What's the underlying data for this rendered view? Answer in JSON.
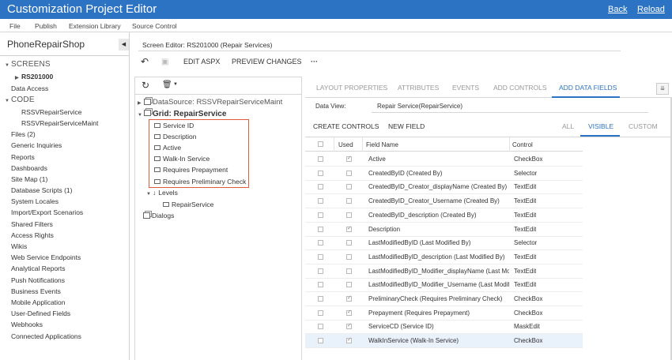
{
  "app": {
    "title": "Customization Project Editor",
    "back": "Back",
    "reload": "Reload"
  },
  "menu": {
    "file": "File",
    "publish": "Publish",
    "extension_library": "Extension Library",
    "source_control": "Source Control"
  },
  "sidebar": {
    "project": "PhoneRepairShop",
    "screens_label": "SCREENS",
    "screen_item": "RS201000",
    "data_access": "Data Access",
    "code_label": "CODE",
    "code_items": [
      "RSSVRepairService",
      "RSSVRepairServiceMaint"
    ],
    "items": [
      "Files (2)",
      "Generic Inquiries",
      "Reports",
      "Dashboards",
      "Site Map (1)",
      "Database Scripts (1)",
      "System Locales",
      "Import/Export Scenarios",
      "Shared Filters",
      "Access Rights",
      "Wikis",
      "Web Service Endpoints",
      "Analytical Reports",
      "Push Notifications",
      "Business Events",
      "Mobile Application",
      "User-Defined Fields",
      "Webhooks",
      "Connected Applications"
    ]
  },
  "editor": {
    "header": "Screen Editor: RS201000 (Repair Services)",
    "edit_aspx": "EDIT ASPX",
    "preview_changes": "PREVIEW CHANGES",
    "more": "···"
  },
  "tree": {
    "datasource": "DataSource: RSSVRepairServiceMaint",
    "grid": "Grid: RepairService",
    "fields": [
      "Service ID",
      "Description",
      "Active",
      "Walk-In Service",
      "Requires Prepayment",
      "Requires Preliminary Check"
    ],
    "levels": "Levels",
    "level_item": "RepairService",
    "dialogs": "Dialogs"
  },
  "tabs": [
    "LAYOUT PROPERTIES",
    "ATTRIBUTES",
    "EVENTS",
    "ADD CONTROLS",
    "ADD DATA FIELDS"
  ],
  "add_fields": {
    "data_view_label": "Data View:",
    "data_view_value": "Repair Service(RepairService)",
    "create_controls": "CREATE CONTROLS",
    "new_field": "NEW FIELD",
    "filters": [
      "ALL",
      "VISIBLE",
      "CUSTOM"
    ],
    "columns": {
      "used": "Used",
      "field_name": "Field Name",
      "control": "Control"
    },
    "rows": [
      {
        "used": true,
        "field": "Active",
        "control": "CheckBox"
      },
      {
        "used": false,
        "field": "CreatedByID (Created By)",
        "control": "Selector"
      },
      {
        "used": false,
        "field": "CreatedByID_Creator_displayName (Created By)",
        "control": "TextEdit"
      },
      {
        "used": false,
        "field": "CreatedByID_Creator_Username (Created By)",
        "control": "TextEdit"
      },
      {
        "used": false,
        "field": "CreatedByID_description (Created By)",
        "control": "TextEdit"
      },
      {
        "used": true,
        "field": "Description",
        "control": "TextEdit"
      },
      {
        "used": false,
        "field": "LastModifiedByID (Last Modified By)",
        "control": "Selector"
      },
      {
        "used": false,
        "field": "LastModifiedByID_description (Last Modified By)",
        "control": "TextEdit"
      },
      {
        "used": false,
        "field": "LastModifiedByID_Modifier_displayName (Last Mo",
        "control": "TextEdit"
      },
      {
        "used": false,
        "field": "LastModifiedByID_Modifier_Username (Last Modifie",
        "control": "TextEdit"
      },
      {
        "used": true,
        "field": "PreliminaryCheck (Requires Preliminary Check)",
        "control": "CheckBox"
      },
      {
        "used": true,
        "field": "Prepayment (Requires Prepayment)",
        "control": "CheckBox"
      },
      {
        "used": true,
        "field": "ServiceCD (Service ID)",
        "control": "MaskEdit"
      },
      {
        "used": true,
        "field": "WalkInService (Walk-In Service)",
        "control": "CheckBox"
      }
    ]
  },
  "colors": {
    "brand": "#2d73c4",
    "highlight": "#e05a3c"
  }
}
